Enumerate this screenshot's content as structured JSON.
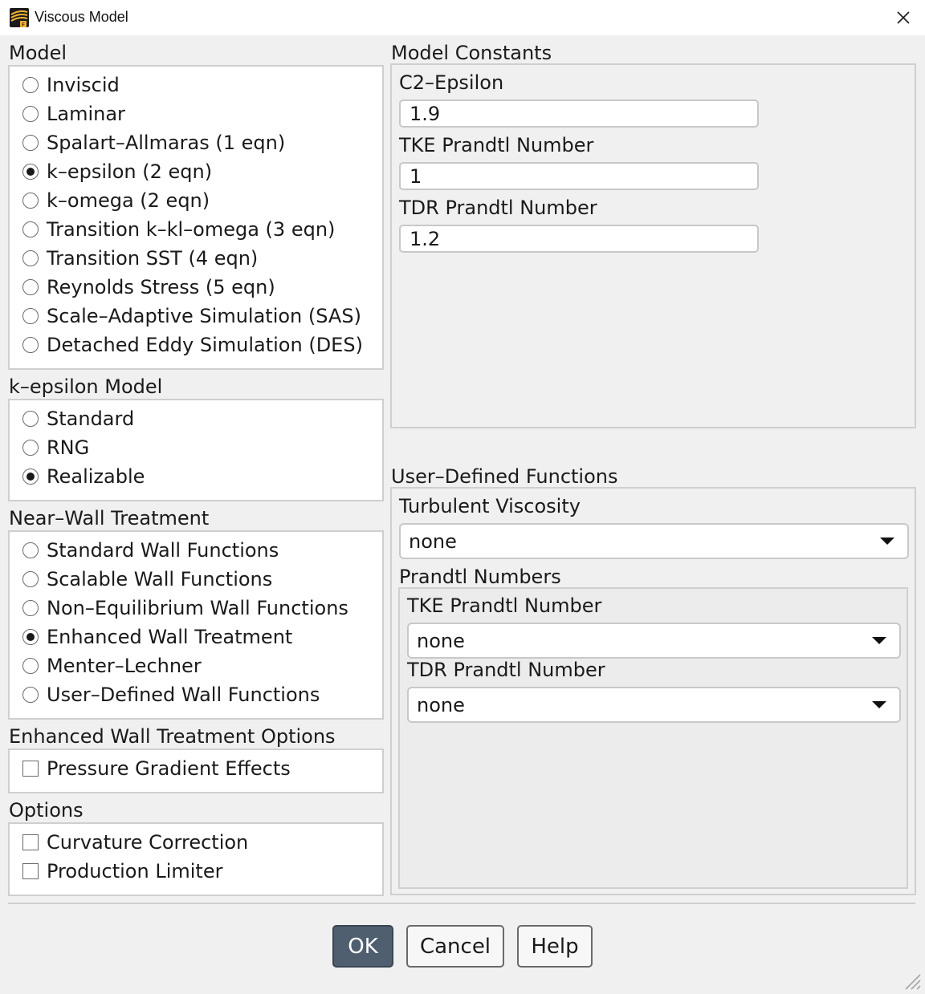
{
  "window": {
    "title": "Viscous Model"
  },
  "model": {
    "title": "Model",
    "options": [
      "Inviscid",
      "Laminar",
      "Spalart–Allmaras (1 eqn)",
      "k–epsilon (2 eqn)",
      "k–omega (2 eqn)",
      "Transition k–kl–omega (3 eqn)",
      "Transition SST (4 eqn)",
      "Reynolds Stress (5 eqn)",
      "Scale–Adaptive Simulation (SAS)",
      "Detached Eddy Simulation (DES)"
    ],
    "selected": "k–epsilon (2 eqn)"
  },
  "kepsilon_model": {
    "title": "k–epsilon Model",
    "options": [
      "Standard",
      "RNG",
      "Realizable"
    ],
    "selected": "Realizable"
  },
  "near_wall": {
    "title": "Near–Wall Treatment",
    "options": [
      "Standard Wall Functions",
      "Scalable Wall Functions",
      "Non–Equilibrium Wall Functions",
      "Enhanced Wall Treatment",
      "Menter–Lechner",
      "User–Defined Wall Functions"
    ],
    "selected": "Enhanced Wall Treatment"
  },
  "enhanced_wall_options": {
    "title": "Enhanced Wall Treatment Options",
    "checkboxes": [
      {
        "label": "Pressure Gradient Effects",
        "checked": false
      }
    ]
  },
  "options": {
    "title": "Options",
    "checkboxes": [
      {
        "label": "Curvature Correction",
        "checked": false
      },
      {
        "label": "Production Limiter",
        "checked": false
      }
    ]
  },
  "model_constants": {
    "title": "Model Constants",
    "fields": [
      {
        "label": "C2–Epsilon",
        "value": "1.9"
      },
      {
        "label": "TKE Prandtl Number",
        "value": "1"
      },
      {
        "label": "TDR Prandtl Number",
        "value": "1.2"
      }
    ]
  },
  "udf": {
    "title": "User–Defined Functions",
    "turbulent_viscosity": {
      "label": "Turbulent Viscosity",
      "value": "none"
    },
    "prandtl_numbers": {
      "title": "Prandtl Numbers",
      "tke": {
        "label": "TKE Prandtl Number",
        "value": "none"
      },
      "tdr": {
        "label": "TDR Prandtl Number",
        "value": "none"
      }
    }
  },
  "buttons": {
    "ok": "OK",
    "cancel": "Cancel",
    "help": "Help"
  },
  "icons": {
    "window": "fluent-app-icon",
    "close": "close-icon",
    "dropdown": "chevron-down-icon",
    "resize": "resize-grip-icon"
  },
  "colors": {
    "primary_button": "#4f5f70",
    "panel": "#f0f0f0",
    "border": "#cfcfcf"
  }
}
